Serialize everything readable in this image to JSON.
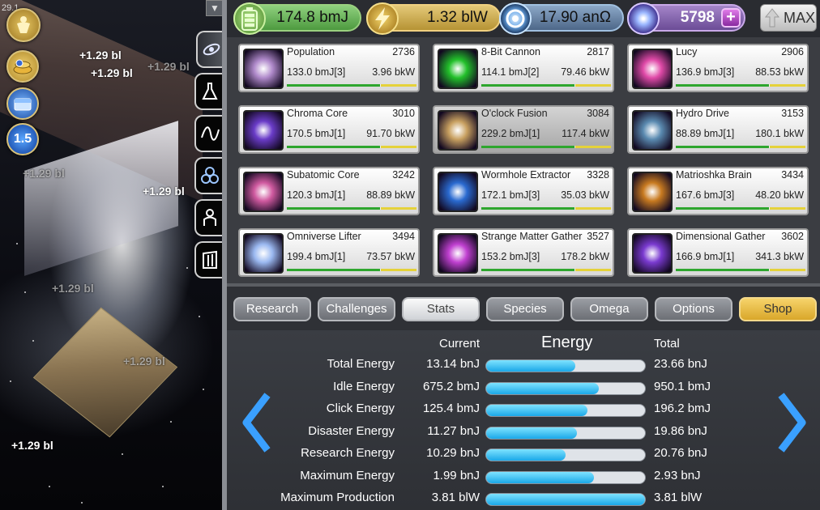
{
  "left_panel": {
    "corner_value": "29.1",
    "floating_numbers": [
      "+1.29 bl",
      "+1.29 bl",
      "+1.29 bl",
      "+1.29 bl",
      "+1.29 bl",
      "+1.29 bl",
      "+1.29 bl",
      "+1.29 bl"
    ],
    "buttons": [
      {
        "icon": "golden-figure-icon",
        "label": ""
      },
      {
        "icon": "coin-pile-icon",
        "label": ""
      },
      {
        "icon": "chest-icon",
        "label": ""
      },
      {
        "icon": "multiplier-icon",
        "label": "1.5"
      }
    ],
    "side_tabs": [
      "galaxy-icon",
      "flask-icon",
      "wave-icon",
      "rings-icon",
      "person-icon",
      "gate-icon"
    ]
  },
  "resources": {
    "energy": "174.8 bmJ",
    "power": "1.32 blW",
    "omega": "17.90 anΩ",
    "gems": "5798",
    "max_label": "MAX"
  },
  "producers": [
    {
      "name": "Population",
      "level": "2736",
      "cost": "133.0 bmJ[3]",
      "production": "3.96 bkW",
      "progress": 0.72,
      "color": "#b08acb"
    },
    {
      "name": "8-Bit Cannon",
      "level": "2817",
      "cost": "114.1 bmJ[2]",
      "production": "79.46 bkW",
      "progress": 0.72,
      "color": "#22c02a"
    },
    {
      "name": "Lucy",
      "level": "2906",
      "cost": "136.9 bmJ[3]",
      "production": "88.53 bkW",
      "progress": 0.72,
      "color": "#e04aa8"
    },
    {
      "name": "Chroma Core",
      "level": "3010",
      "cost": "170.5 bmJ[1]",
      "production": "91.70 bkW",
      "progress": 0.72,
      "color": "#6a3cc8"
    },
    {
      "name": "O'clock Fusion",
      "level": "3084",
      "cost": "229.2 bmJ[1]",
      "production": "117.4 bkW",
      "progress": 0.72,
      "color": "#c8a060"
    },
    {
      "name": "Hydro Drive",
      "level": "3153",
      "cost": "88.89 bmJ[1]",
      "production": "180.1 bkW",
      "progress": 0.72,
      "color": "#5a8ab0"
    },
    {
      "name": "Subatomic Core",
      "level": "3242",
      "cost": "120.3 bmJ[1]",
      "production": "88.89 bkW",
      "progress": 0.72,
      "color": "#d05aa0"
    },
    {
      "name": "Wormhole Extractor",
      "level": "3328",
      "cost": "172.1 bmJ[3]",
      "production": "35.03 bkW",
      "progress": 0.72,
      "color": "#2a6ad0"
    },
    {
      "name": "Matrioshka Brain",
      "level": "3434",
      "cost": "167.6 bmJ[3]",
      "production": "48.20 bkW",
      "progress": 0.72,
      "color": "#c87a20"
    },
    {
      "name": "Omniverse Lifter",
      "level": "3494",
      "cost": "199.4 bmJ[1]",
      "production": "73.57 bkW",
      "progress": 0.72,
      "color": "#9ab8f0"
    },
    {
      "name": "Strange Matter Gather",
      "level": "3527",
      "cost": "153.2 bmJ[3]",
      "production": "178.2 bkW",
      "progress": 0.72,
      "color": "#c040d0"
    },
    {
      "name": "Dimensional Gather",
      "level": "3602",
      "cost": "166.9 bmJ[1]",
      "production": "341.3 bkW",
      "progress": 0.72,
      "color": "#7a3ad0"
    }
  ],
  "nav": {
    "tabs": [
      "Research",
      "Challenges",
      "Stats",
      "Species",
      "Omega",
      "Options",
      "Shop"
    ],
    "active": "Stats"
  },
  "stats": {
    "title": "Energy",
    "current_header": "Current",
    "total_header": "Total",
    "rows": [
      {
        "label": "Total Energy",
        "current": "13.14 bnJ",
        "total": "23.66 bnJ",
        "ratio": 0.56
      },
      {
        "label": "Idle Energy",
        "current": "675.2 bmJ",
        "total": "950.1 bmJ",
        "ratio": 0.71
      },
      {
        "label": "Click Energy",
        "current": "125.4 bmJ",
        "total": "196.2 bmJ",
        "ratio": 0.64
      },
      {
        "label": "Disaster Energy",
        "current": "11.27 bnJ",
        "total": "19.86 bnJ",
        "ratio": 0.57
      },
      {
        "label": "Research Energy",
        "current": "10.29 bnJ",
        "total": "20.76 bnJ",
        "ratio": 0.5
      },
      {
        "label": "Maximum Energy",
        "current": "1.99 bnJ",
        "total": "2.93 bnJ",
        "ratio": 0.68
      },
      {
        "label": "Maximum Production",
        "current": "3.81 blW",
        "total": "3.81 blW",
        "ratio": 1.0
      }
    ]
  },
  "colors": {
    "accent_blue": "#1aa8e8",
    "shop_gold": "#d9a72a",
    "energy_green": "#4d9a3f"
  }
}
